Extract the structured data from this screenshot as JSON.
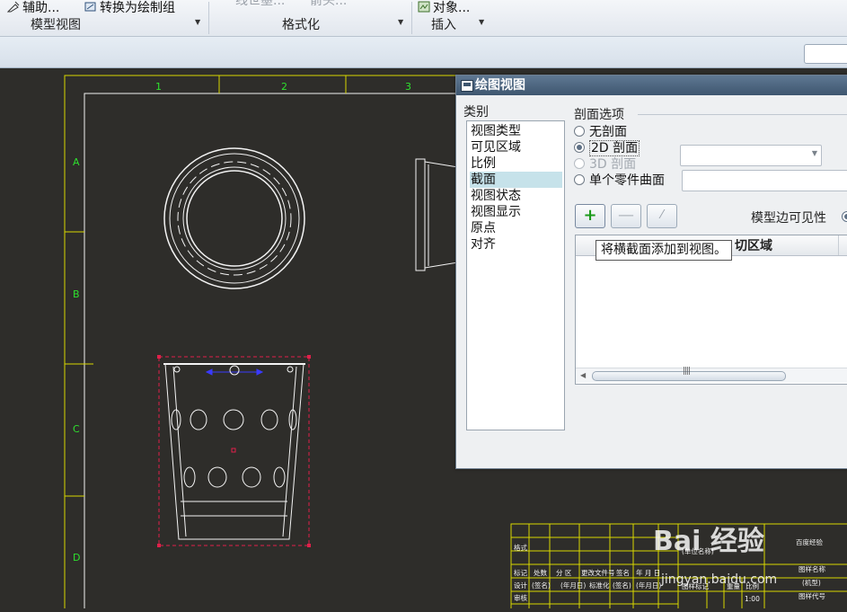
{
  "ribbon": {
    "items": [
      {
        "label": "辅助...",
        "disabled": false,
        "icon": "aux-icon"
      },
      {
        "label": "转换为绘制组",
        "disabled": false,
        "icon": "convert-icon"
      },
      {
        "label": "线世墨...",
        "disabled": true
      },
      {
        "label": "箭头...",
        "disabled": true
      },
      {
        "label": "对象...",
        "disabled": false,
        "icon": "object-icon"
      }
    ],
    "groups": [
      "模型视图",
      "格式化",
      "插入"
    ]
  },
  "drawing": {
    "col_labels": [
      "1",
      "2",
      "3"
    ],
    "row_labels": [
      "A",
      "B",
      "C",
      "D"
    ],
    "title_block": {
      "header_left": "格式",
      "cells": [
        "标记",
        "处数",
        "分 区",
        "更改文件号",
        "签名",
        "年 月 日",
        "图样标记",
        "重量",
        "比例"
      ],
      "row2": [
        "设计",
        "(签名)",
        "(年月日)",
        "标准化",
        "(签名)",
        "(年月日)"
      ],
      "row3": [
        "审核"
      ],
      "scale_value": "1:00",
      "company": "(单位名称)",
      "right_1": "百度经验",
      "right_2": "图样名称",
      "right_3": "(机型)",
      "right_4": "图样代号"
    }
  },
  "dialog": {
    "title": "绘图视图",
    "category_label": "类别",
    "categories": [
      "视图类型",
      "可见区域",
      "比例",
      "截面",
      "视图状态",
      "视图显示",
      "原点",
      "对齐"
    ],
    "selected_category": "截面",
    "section_options_label": "剖面选项",
    "options": [
      {
        "label": "无剖面",
        "checked": false,
        "disabled": false
      },
      {
        "label": "2D 剖面",
        "checked": true,
        "disabled": false
      },
      {
        "label": "3D 剖面",
        "checked": false,
        "disabled": true
      },
      {
        "label": "单个零件曲面",
        "checked": false,
        "disabled": false
      }
    ],
    "buttons": {
      "add": "+",
      "remove": "—",
      "edit": "⁄"
    },
    "visibility_label": "模型边可见性",
    "table_header": "切区域",
    "tooltip": "将横截面添加到视图。",
    "scroll_grip": "||||"
  },
  "watermark": {
    "text": "Bai 经验",
    "url": "jingyan.baidu.com"
  }
}
